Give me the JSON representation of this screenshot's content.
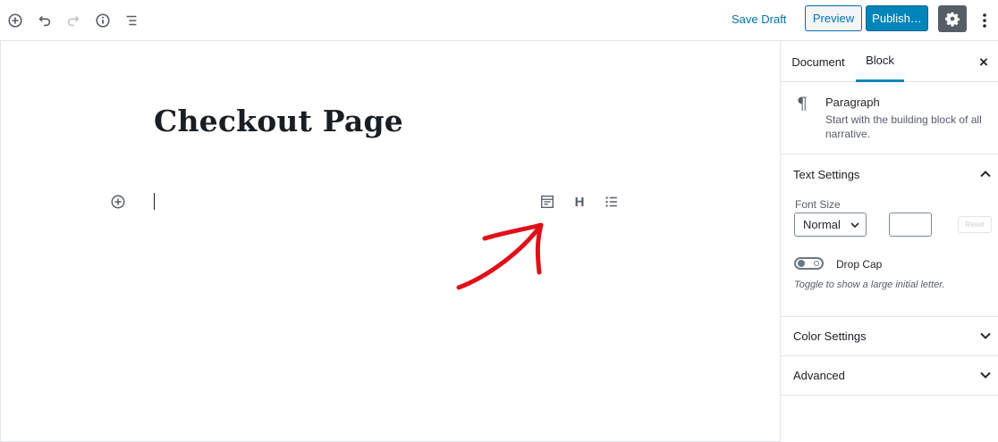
{
  "toolbar": {
    "save_draft": "Save Draft",
    "preview": "Preview",
    "publish": "Publish…"
  },
  "editor": {
    "post_title": "Checkout Page"
  },
  "block_toolbar": {
    "heading_glyph": "H"
  },
  "sidebar": {
    "tabs": [
      {
        "label": "Document",
        "active": false
      },
      {
        "label": "Block",
        "active": true
      }
    ],
    "close_glyph": "×",
    "block": {
      "icon_glyph": "¶",
      "name": "Paragraph",
      "description": "Start with the building block of all narrative."
    },
    "text_settings": {
      "title": "Text Settings",
      "expanded": true,
      "font_size_label": "Font Size",
      "font_size_value": "Normal",
      "custom_size_value": "",
      "reset_label": "Reset",
      "drop_cap_label": "Drop Cap",
      "drop_cap_enabled": false,
      "drop_cap_help": "Toggle to show a large initial letter."
    },
    "color_settings": {
      "title": "Color Settings",
      "expanded": false
    },
    "advanced": {
      "title": "Advanced",
      "expanded": false
    }
  },
  "colors": {
    "accent": "#0085ba",
    "link": "#0073aa",
    "annotation_arrow": "#e0101a"
  }
}
